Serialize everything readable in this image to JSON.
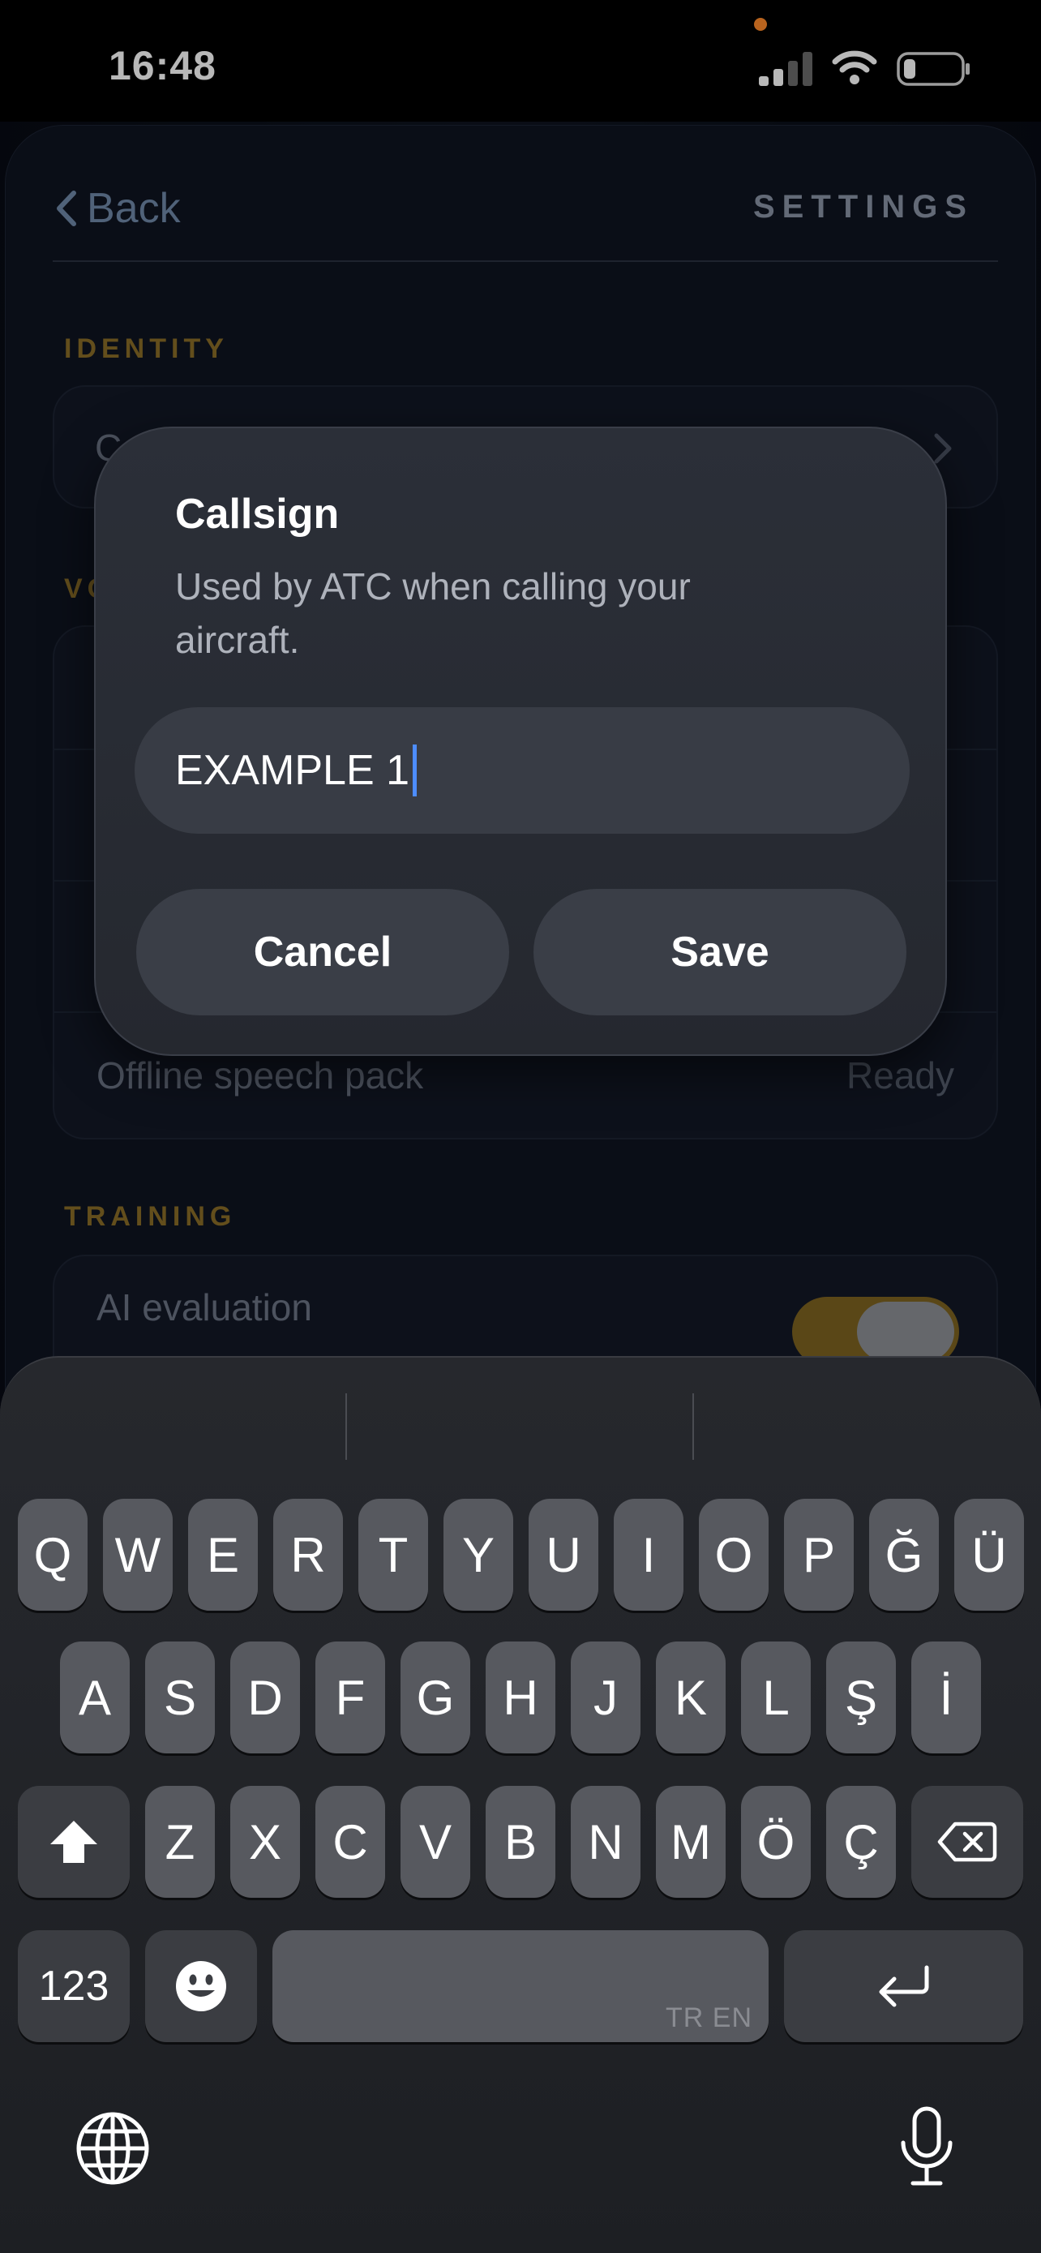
{
  "status_bar": {
    "time": "16:48"
  },
  "nav": {
    "back_label": "Back",
    "title": "SETTINGS"
  },
  "sections": {
    "identity": {
      "label": "IDENTITY",
      "callsign_row_label_visible": "Ca"
    },
    "voice": {
      "label_visible": "VO",
      "offline_pack_label": "Offline speech pack",
      "offline_pack_value": "Ready"
    },
    "training": {
      "label": "TRAINING",
      "ai_evaluation_label": "AI evaluation",
      "ai_evaluation_on": true
    }
  },
  "dialog": {
    "title": "Callsign",
    "message": "Used by ATC when calling your aircraft.",
    "input_value": "EXAMPLE 1",
    "cancel_label": "Cancel",
    "save_label": "Save"
  },
  "keyboard": {
    "row1": [
      "Q",
      "W",
      "E",
      "R",
      "T",
      "Y",
      "U",
      "I",
      "O",
      "P",
      "Ğ",
      "Ü"
    ],
    "row2": [
      "A",
      "S",
      "D",
      "F",
      "G",
      "H",
      "J",
      "K",
      "L",
      "Ş",
      "İ"
    ],
    "row3": [
      "Z",
      "X",
      "C",
      "V",
      "B",
      "N",
      "M",
      "Ö",
      "Ç"
    ],
    "numbers_label": "123",
    "space_hint": "TR EN"
  },
  "icons": {
    "back": "chevron-left-icon",
    "row_chevron": "chevron-right-icon",
    "signal": "cellular-signal-icon",
    "wifi": "wifi-icon",
    "battery": "battery-icon",
    "shift": "shift-icon",
    "delete": "delete-icon",
    "emoji": "emoji-icon",
    "return": "return-icon",
    "globe": "globe-icon",
    "microphone": "microphone-icon"
  },
  "colors": {
    "accent_gold": "#8a6d28",
    "toggle_on": "#7d6320",
    "caret": "#4d8dff"
  }
}
